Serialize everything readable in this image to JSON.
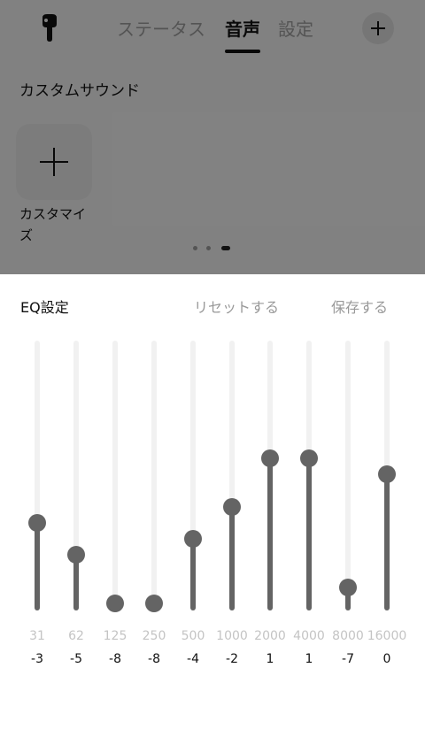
{
  "header": {
    "tabs": [
      {
        "label": "ステータス",
        "active": false
      },
      {
        "label": "音声",
        "active": true
      },
      {
        "label": "設定",
        "active": false
      }
    ]
  },
  "custom_sound": {
    "title": "カスタムサウンド",
    "card_label": "カスタマイズ",
    "page_count": 3,
    "current_page": 3
  },
  "eq": {
    "title": "EQ設定",
    "reset_label": "リセットする",
    "save_label": "保存する",
    "gain_range": [
      -8,
      1
    ],
    "bands": [
      {
        "freq": "31",
        "gain": "-3"
      },
      {
        "freq": "62",
        "gain": "-5"
      },
      {
        "freq": "125",
        "gain": "-8"
      },
      {
        "freq": "250",
        "gain": "-8"
      },
      {
        "freq": "500",
        "gain": "-4"
      },
      {
        "freq": "1000",
        "gain": "-2"
      },
      {
        "freq": "2000",
        "gain": "1"
      },
      {
        "freq": "4000",
        "gain": "1"
      },
      {
        "freq": "8000",
        "gain": "-7"
      },
      {
        "freq": "16000",
        "gain": "0"
      }
    ]
  },
  "colors": {
    "accent": "#646464",
    "overlay": "#000000"
  }
}
